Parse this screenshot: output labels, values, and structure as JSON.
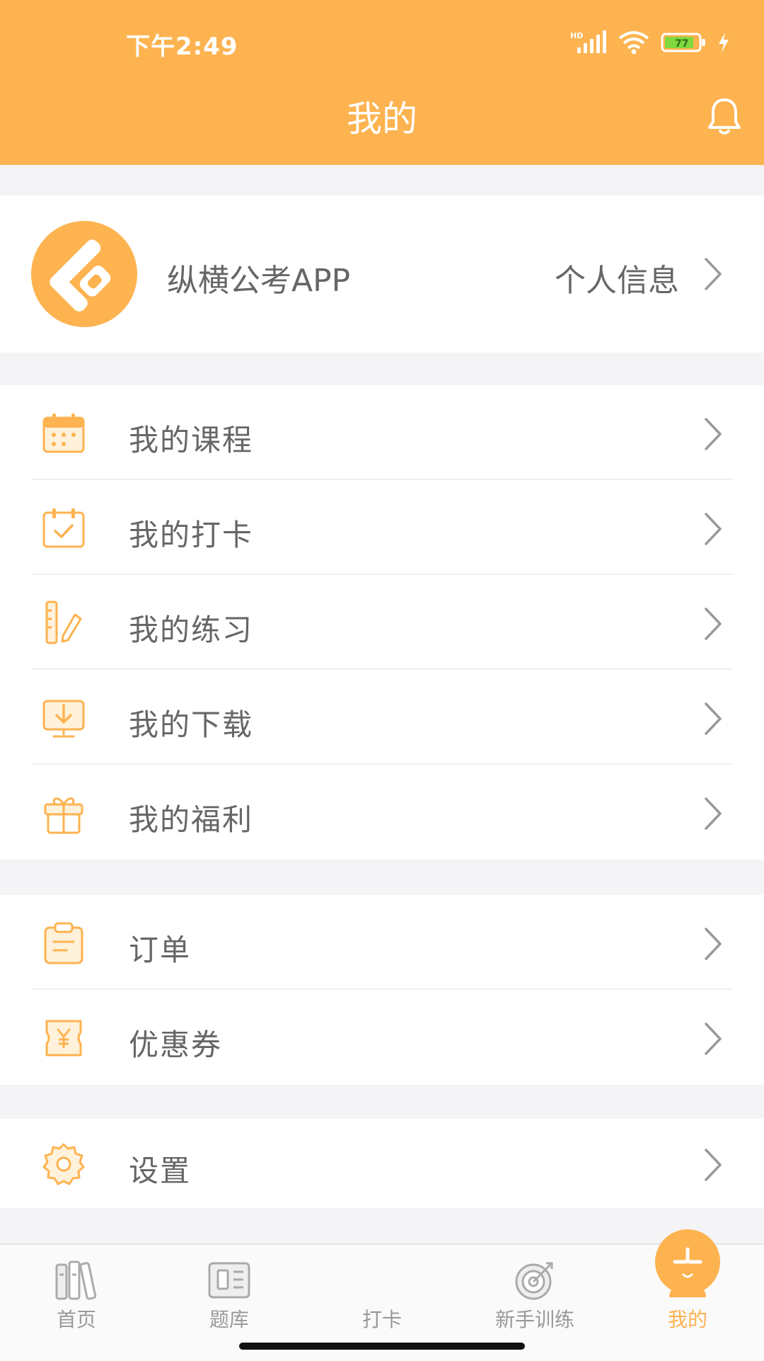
{
  "status": {
    "time": "下午2:49",
    "hd_label": "HD",
    "battery_level": "77"
  },
  "header": {
    "title": "我的"
  },
  "profile": {
    "name": "纵横公考APP",
    "info_label": "个人信息"
  },
  "menu_group1": [
    {
      "label": "我的课程",
      "icon": "calendar-icon"
    },
    {
      "label": "我的打卡",
      "icon": "checkin-calendar-icon"
    },
    {
      "label": "我的练习",
      "icon": "ruler-pencil-icon"
    },
    {
      "label": "我的下载",
      "icon": "download-monitor-icon"
    },
    {
      "label": "我的福利",
      "icon": "gift-icon"
    }
  ],
  "menu_group2": [
    {
      "label": "订单",
      "icon": "clipboard-icon"
    },
    {
      "label": "优惠券",
      "icon": "coupon-icon"
    }
  ],
  "menu_group3": [
    {
      "label": "设置",
      "icon": "gear-icon"
    }
  ],
  "tabbar": [
    {
      "label": "首页",
      "icon": "books-icon",
      "active": false
    },
    {
      "label": "题库",
      "icon": "question-bank-icon",
      "active": false
    },
    {
      "label": "打卡",
      "icon": "plus-icon",
      "active": false
    },
    {
      "label": "新手训练",
      "icon": "target-icon",
      "active": false
    },
    {
      "label": "我的",
      "icon": "user-icon",
      "active": true
    }
  ],
  "colors": {
    "accent": "#fdb350",
    "background": "#f4f4f6",
    "text": "#666666",
    "inactive_tab": "#999999"
  }
}
